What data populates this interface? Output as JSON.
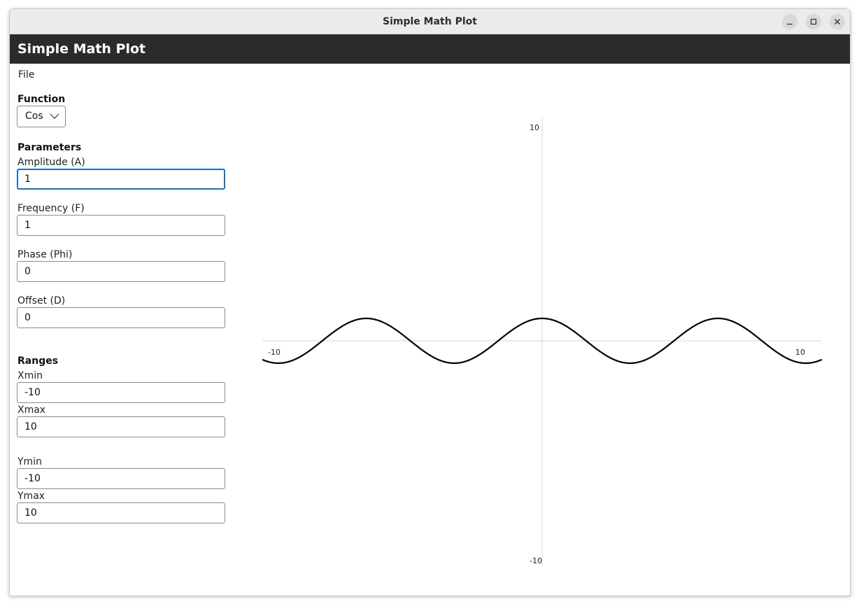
{
  "window": {
    "title": "Simple Math Plot",
    "controls": [
      "minimize-icon",
      "maximize-icon",
      "close-icon"
    ]
  },
  "app": {
    "title": "Simple Math Plot"
  },
  "menu": {
    "file": "File"
  },
  "function": {
    "heading": "Function",
    "selected": "Cos"
  },
  "parameters": {
    "heading": "Parameters",
    "amplitude": {
      "label": "Amplitude (A)",
      "value": "1"
    },
    "frequency": {
      "label": "Frequency (F)",
      "value": "1"
    },
    "phase": {
      "label": "Phase (Phi)",
      "value": "0"
    },
    "offset": {
      "label": "Offset (D)",
      "value": "0"
    }
  },
  "ranges": {
    "heading": "Ranges",
    "xmin": {
      "label": "Xmin",
      "value": "-10"
    },
    "xmax": {
      "label": "Xmax",
      "value": "10"
    },
    "ymin": {
      "label": "Ymin",
      "value": "-10"
    },
    "ymax": {
      "label": "Ymax",
      "value": "10"
    }
  },
  "chart_data": {
    "type": "line",
    "function": "cos",
    "amplitude": 1,
    "frequency": 1,
    "phase": 0,
    "offset": 0,
    "xlim": [
      -10,
      10
    ],
    "ylim": [
      -10,
      10
    ],
    "tick_labels": {
      "xmin": "-10",
      "xmax": "10",
      "ymin": "-10",
      "ymax": "10"
    },
    "line_color": "#000000",
    "axis_color": "#d4d4d4"
  }
}
